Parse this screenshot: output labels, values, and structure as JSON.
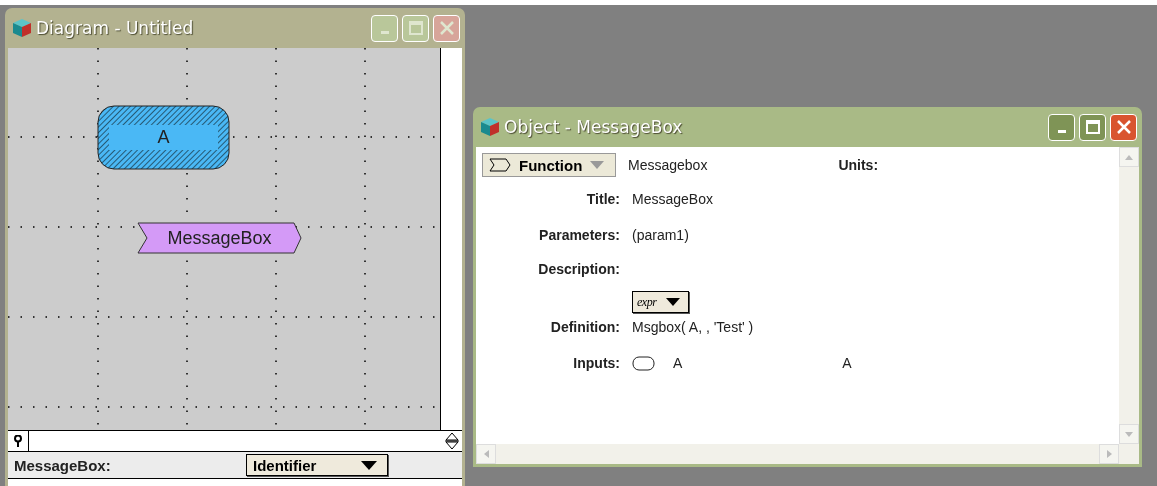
{
  "diagram_window": {
    "title": "Diagram - Untitled",
    "nodes": [
      {
        "kind": "variable",
        "label": "A"
      },
      {
        "kind": "function",
        "label": "MessageBox"
      }
    ],
    "footer": {
      "label": "MessageBox:",
      "dropdown": "Identifier"
    }
  },
  "object_window": {
    "title": "Object - MessageBox",
    "class_menu": "Function",
    "identifier": "Messagebox",
    "units_label": "Units:",
    "fields": [
      {
        "kind": "text",
        "label": "Title:",
        "value": "MessageBox"
      },
      {
        "kind": "text",
        "label": "Parameters:",
        "value": "(param1)"
      },
      {
        "kind": "text",
        "label": "Description:"
      },
      {
        "kind": "definition",
        "label": "Definition:",
        "mode": "expr",
        "value": "Msgbox( A, , 'Test' )"
      },
      {
        "kind": "inputs",
        "label": "Inputs:",
        "values": [
          "A",
          "A"
        ]
      }
    ]
  }
}
